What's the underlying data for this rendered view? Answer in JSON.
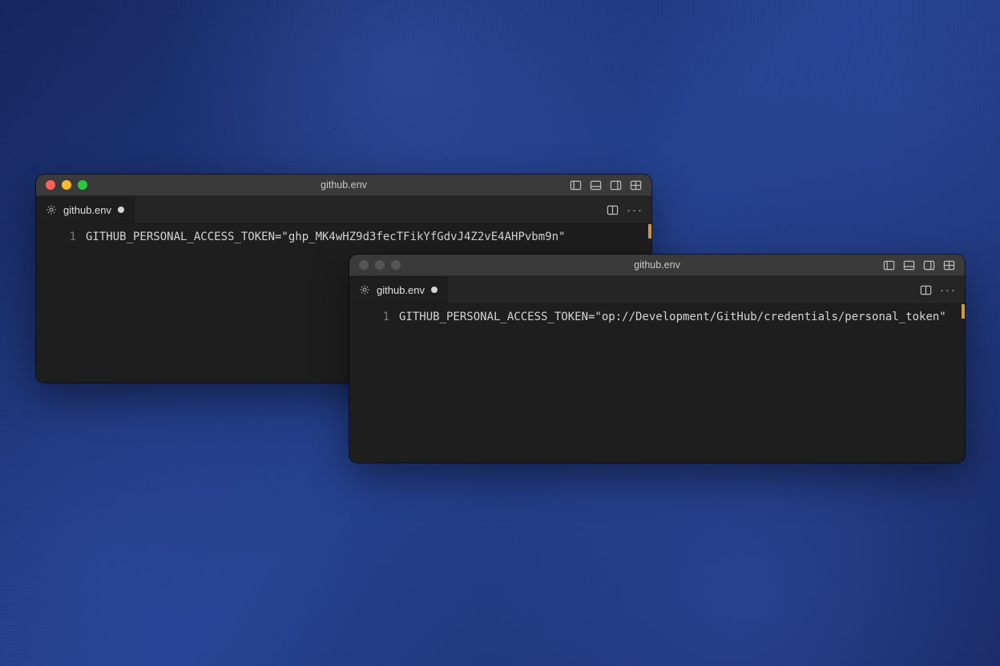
{
  "window1": {
    "title": "github.env",
    "tab_filename": "github.env",
    "line_number": "1",
    "code": "GITHUB_PERSONAL_ACCESS_TOKEN=\"ghp_MK4wHZ9d3fecTFikYfGdvJ4Z2vE4AHPvbm9n\"",
    "traffic": {
      "close": "close",
      "minimize": "minimize",
      "zoom": "zoom"
    },
    "icons": {
      "panel_left": "panel-left-icon",
      "panel_bottom": "panel-bottom-icon",
      "panel_right": "panel-right-icon",
      "layout": "layout-icon",
      "split": "split-editor-icon",
      "more": "more-icon",
      "gear": "gear-icon",
      "modified": "modified-dot"
    }
  },
  "window2": {
    "title": "github.env",
    "tab_filename": "github.env",
    "line_number": "1",
    "code": "GITHUB_PERSONAL_ACCESS_TOKEN=\"op://Development/GitHub/credentials/personal_token\"",
    "traffic": {
      "close": "close",
      "minimize": "minimize",
      "zoom": "zoom"
    },
    "icons": {
      "panel_left": "panel-left-icon",
      "panel_bottom": "panel-bottom-icon",
      "panel_right": "panel-right-icon",
      "layout": "layout-icon",
      "split": "split-editor-icon",
      "more": "more-icon",
      "gear": "gear-icon",
      "modified": "modified-dot"
    }
  }
}
